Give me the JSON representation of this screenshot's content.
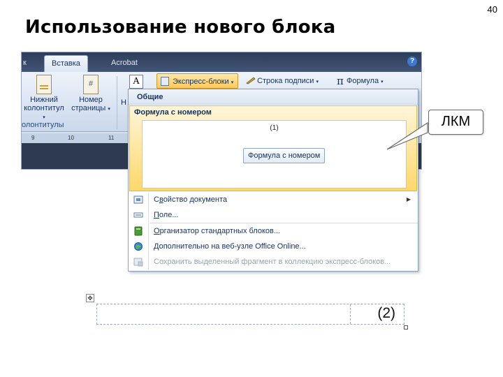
{
  "slide": {
    "number": "40",
    "title": "Использование нового блока"
  },
  "ribbon": {
    "tabs": [
      {
        "label": "к"
      },
      {
        "label": "Вставка"
      },
      {
        "label": "Acrobat"
      }
    ],
    "active_tab": "Вставка",
    "groups": {
      "footer_line1": "Нижний",
      "footer_line2": "колонтитул",
      "pagenum_line1": "Номер",
      "pagenum_line2": "страницы",
      "headers_footers_label": "олонтитулы",
      "partial_letter": "Н"
    },
    "text_group": {
      "express_blocks": "Экспресс-блоки",
      "signature_line": "Строка подписи",
      "formula": "Формула",
      "big_a": "A"
    },
    "ruler": {
      "ticks": [
        "9",
        "10",
        "11"
      ]
    }
  },
  "dropdown": {
    "section_title": "Общие",
    "gallery_item": {
      "title": "Формула с номером",
      "preview_equation_number": "(1)",
      "preview_button": "Формула с номером"
    },
    "menu": [
      {
        "label": "Свойство документа",
        "underline_char": "в",
        "has_submenu": true,
        "disabled": false,
        "icon": "document-property-icon"
      },
      {
        "label": "Поле...",
        "underline_char": "П",
        "has_submenu": false,
        "disabled": false,
        "icon": "field-icon"
      },
      {
        "label": "Организатор стандартных блоков...",
        "underline_char": "О",
        "has_submenu": false,
        "disabled": false,
        "icon": "building-blocks-organizer-icon"
      },
      {
        "label": "Дополнительно на веб-узле Office Online...",
        "underline_char": "Д",
        "has_submenu": false,
        "disabled": false,
        "icon": "office-online-icon"
      },
      {
        "label": "Сохранить выделенный фрагмент в коллекцию экспресс-блоков...",
        "underline_char": "",
        "has_submenu": false,
        "disabled": true,
        "icon": "save-selection-icon"
      }
    ]
  },
  "callout": {
    "text": "ЛКМ"
  },
  "result": {
    "equation_number": "(2)"
  },
  "colors": {
    "highlight_orange": "#ffd86a",
    "ribbon_blue": "#d8e2ef",
    "menu_text": "#15325e"
  }
}
